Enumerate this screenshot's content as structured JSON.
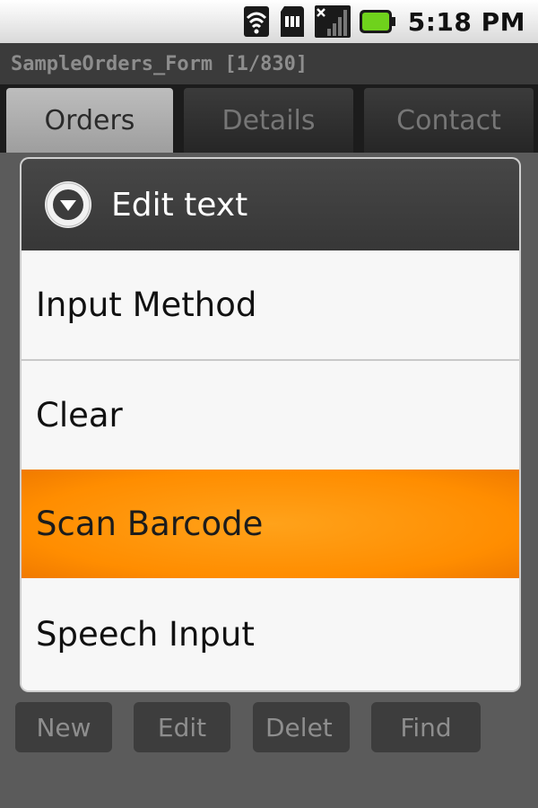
{
  "status_bar": {
    "time": "5:18 PM",
    "icons": [
      "wifi-icon",
      "sd-card-icon",
      "signal-icon",
      "battery-icon"
    ]
  },
  "app": {
    "title": "SampleOrders_Form [1/830]"
  },
  "tabs": [
    {
      "label": "Orders"
    },
    {
      "label": "Details"
    },
    {
      "label": "Contact"
    }
  ],
  "dialog": {
    "title": "Edit text",
    "items": [
      {
        "label": "Input Method"
      },
      {
        "label": "Clear"
      },
      {
        "label": "Scan Barcode"
      },
      {
        "label": "Speech Input"
      }
    ],
    "highlight_color": "#ff8c00"
  },
  "buttons": [
    {
      "label": "New"
    },
    {
      "label": "Edit"
    },
    {
      "label": "Delet"
    },
    {
      "label": "Find"
    }
  ]
}
